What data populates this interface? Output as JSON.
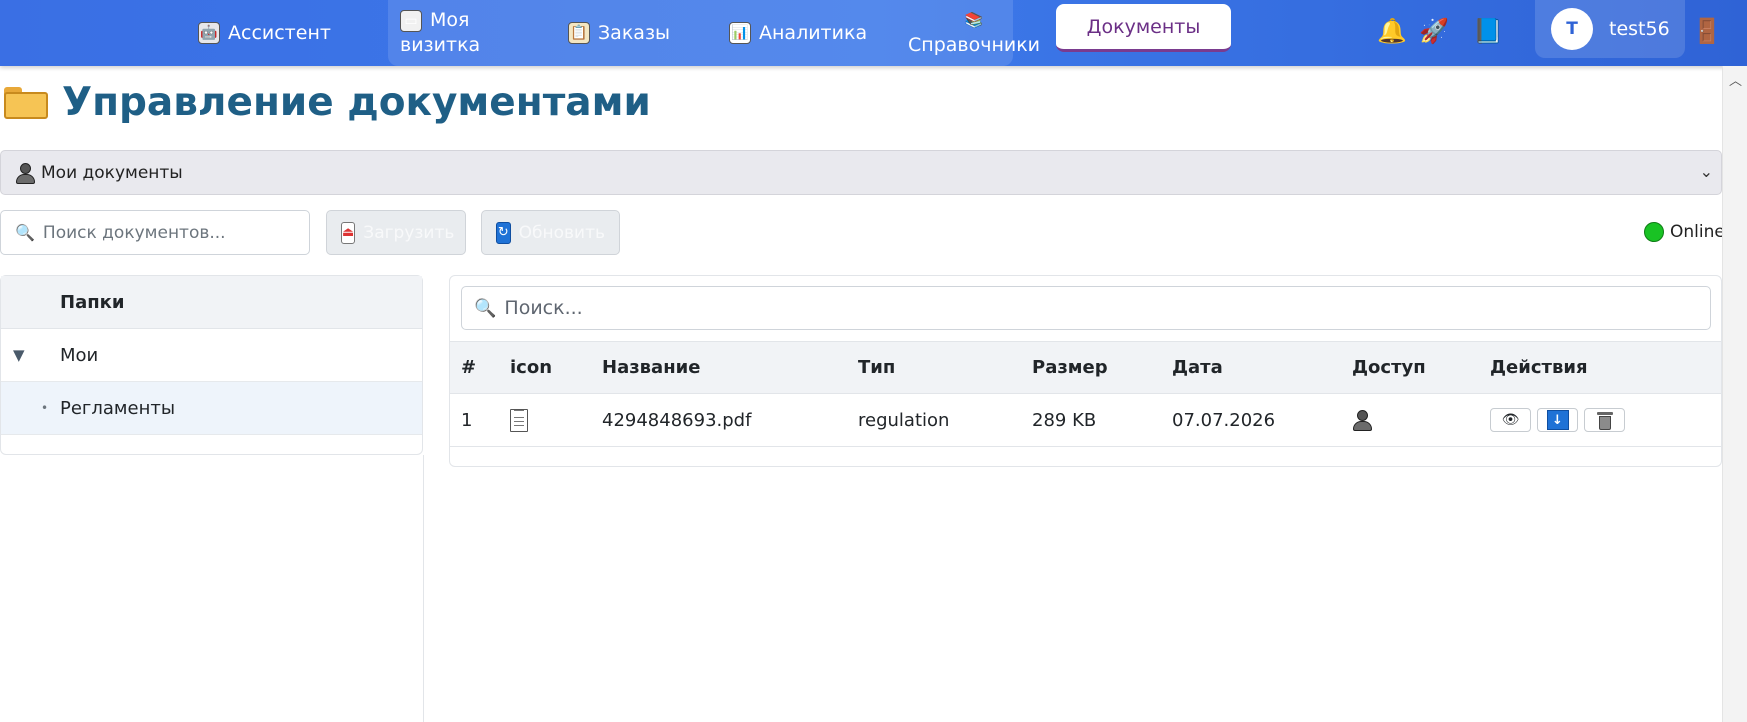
{
  "nav": {
    "items": [
      {
        "label": "Ассистент",
        "icon": "robot-icon"
      },
      {
        "label_line1": "Моя",
        "label_line2": "визитка",
        "icon": "card-icon"
      },
      {
        "label": "Заказы",
        "icon": "clipboard-icon"
      },
      {
        "label": "Аналитика",
        "icon": "chart-icon"
      },
      {
        "label": "Справочники",
        "icon": "books-icon"
      }
    ],
    "active": "Документы",
    "right_icons": [
      "bell-icon",
      "rocket-icon",
      "book-icon",
      "door-icon"
    ]
  },
  "user": {
    "initial": "T",
    "name": "test56"
  },
  "page": {
    "title": "Управление документами",
    "title_icon": "folder-icon"
  },
  "scope": {
    "label": "Мои документы",
    "icon": "person-icon"
  },
  "toolbar": {
    "search_placeholder": "Поиск документов...",
    "upload_label": "Загрузить",
    "refresh_label": "Обновить",
    "status": "Online",
    "status_color": "#19c224"
  },
  "folders": {
    "header": "Папки",
    "items": [
      {
        "label": "Мои",
        "expanded": true
      },
      {
        "label": "Регламенты",
        "selected": true
      }
    ]
  },
  "documents": {
    "search_placeholder": "Поиск...",
    "columns": [
      "#",
      "icon",
      "Название",
      "Тип",
      "Размер",
      "Дата",
      "Доступ",
      "Действия"
    ],
    "rows": [
      {
        "num": "1",
        "name": "4294848693.pdf",
        "type": "regulation",
        "size": "289 KB",
        "date": "07.07.2026",
        "access": "person-icon"
      }
    ]
  },
  "colors": {
    "nav_bg": "#3a6fe4",
    "title": "#1f5f86",
    "active_tab_text": "#6b2f86"
  }
}
